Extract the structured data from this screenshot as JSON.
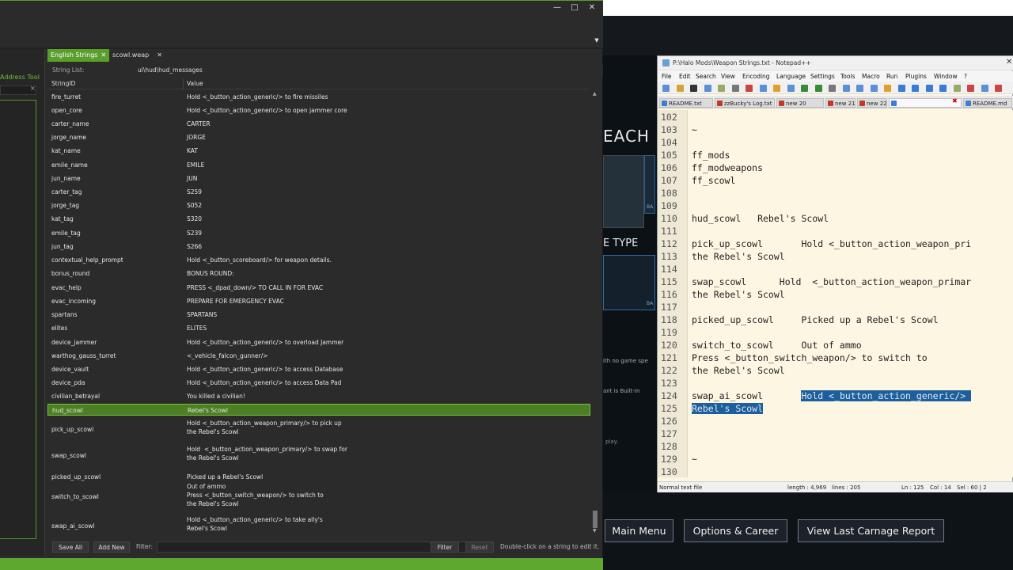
{
  "editor": {
    "address_tool": "Address Tool",
    "tabs": [
      {
        "label": "English Strings",
        "active": true
      },
      {
        "label": "scowl.weap",
        "active": false
      }
    ],
    "string_list_label": "String List:",
    "string_list_value": "ui\\hud\\hud_messages",
    "columns": {
      "id": "StringID",
      "value": "Value"
    },
    "rows": [
      {
        "id": "fire_turret",
        "value": "Hold <_button_action_generic/> to fire missiles"
      },
      {
        "id": "open_core",
        "value": "Hold <_button_action_generic/> to open jammer core"
      },
      {
        "id": "carter_name",
        "value": "CARTER"
      },
      {
        "id": "jorge_name",
        "value": "JORGE"
      },
      {
        "id": "kat_name",
        "value": "KAT"
      },
      {
        "id": "emile_name",
        "value": "EMILE"
      },
      {
        "id": "jun_name",
        "value": "JUN"
      },
      {
        "id": "carter_tag",
        "value": "S259"
      },
      {
        "id": "jorge_tag",
        "value": "S052"
      },
      {
        "id": "kat_tag",
        "value": "S320"
      },
      {
        "id": "emile_tag",
        "value": "S239"
      },
      {
        "id": "jun_tag",
        "value": "S266"
      },
      {
        "id": "contextual_help_prompt",
        "value": "Hold <_button_scoreboard/> for weapon details."
      },
      {
        "id": "bonus_round",
        "value": "BONUS ROUND:"
      },
      {
        "id": "evac_help",
        "value": "PRESS <_dpad_down/> TO CALL IN FOR EVAC"
      },
      {
        "id": "evac_incoming",
        "value": "PREPARE FOR EMERGENCY EVAC"
      },
      {
        "id": "spartans",
        "value": "SPARTANS"
      },
      {
        "id": "elites",
        "value": "ELITES"
      },
      {
        "id": "device_jammer",
        "value": "Hold <_button_action_generic/> to overload Jammer"
      },
      {
        "id": "warthog_gauss_turret",
        "value": "<_vehicle_falcon_gunner/>"
      },
      {
        "id": "device_vault",
        "value": "Hold <_button_action_generic/> to access Database"
      },
      {
        "id": "device_pda",
        "value": "Hold <_button_action_generic/> to access Data Pad"
      },
      {
        "id": "civilian_betrayal",
        "value": "You killed a civilian!"
      },
      {
        "id": "hud_scowl",
        "value": "Rebel's Scowl",
        "selected": true
      },
      {
        "id": "pick_up_scowl",
        "value": "Hold <_button_action_weapon_primary/> to pick up\nthe Rebel's Scowl"
      },
      {
        "id": "swap_scowl",
        "value": "Hold  <_button_action_weapon_primary/> to swap for\nthe Rebel's Scowl"
      },
      {
        "id": "picked_up_scowl",
        "value": "Picked up a Rebel's Scowl"
      },
      {
        "id": "switch_to_scowl",
        "value": "Out of ammo\nPress <_button_switch_weapon/> to switch to\nthe Rebel's Scowl"
      },
      {
        "id": "swap_ai_scowl",
        "value": "Hold <_button_action_generic/> to take ally's\nRebel's Scowl"
      }
    ],
    "buttons": {
      "save_all": "Save All",
      "add_new": "Add New",
      "filter": "Filter",
      "reset": "Reset"
    },
    "filter_label": "Filter:",
    "hint": "Double-click on a string to edit it."
  },
  "game": {
    "fragments": [
      "EACH F",
      "E TYPE",
      "ith no game spe",
      "ant is Built-In",
      "play."
    ],
    "badges": [
      "BA",
      "BA"
    ],
    "buttons": {
      "main_menu": "Main Menu",
      "options": "Options & Career",
      "carnage": "View Last Carnage Report"
    }
  },
  "npp": {
    "title": "P:\\Halo Mods\\Weapon Strings.txt - Notepad++",
    "menu": [
      "File",
      "Edit",
      "Search",
      "View",
      "Encoding",
      "Language",
      "Settings",
      "Tools",
      "Macro",
      "Run",
      "Plugins",
      "Window",
      "?"
    ],
    "tabs": [
      "README.txt",
      "zzBucky's Log.txt",
      "new 20",
      "new 21",
      "new 22",
      "",
      "README.md"
    ],
    "lines": [
      {
        "n": "102",
        "text": ""
      },
      {
        "n": "103",
        "text": "~"
      },
      {
        "n": "104",
        "text": ""
      },
      {
        "n": "105",
        "text": "ff_mods"
      },
      {
        "n": "106",
        "text": "ff_modweapons"
      },
      {
        "n": "107",
        "text": "ff_scowl"
      },
      {
        "n": "108",
        "text": ""
      },
      {
        "n": "109",
        "text": ""
      },
      {
        "n": "110",
        "text": "hud_scowl   Rebel's Scowl"
      },
      {
        "n": "111",
        "text": ""
      },
      {
        "n": "112",
        "text": "pick_up_scowl       Hold <_button_action_weapon_pri"
      },
      {
        "n": "113",
        "text": "the Rebel's Scowl"
      },
      {
        "n": "114",
        "text": ""
      },
      {
        "n": "115",
        "text": "swap_scowl      Hold  <_button_action_weapon_primar"
      },
      {
        "n": "116",
        "text": "the Rebel's Scowl"
      },
      {
        "n": "117",
        "text": ""
      },
      {
        "n": "118",
        "text": "picked_up_scowl     Picked up a Rebel's Scowl"
      },
      {
        "n": "119",
        "text": ""
      },
      {
        "n": "120",
        "text": "switch_to_scowl     Out of ammo"
      },
      {
        "n": "121",
        "text": "Press <_button_switch_weapon/> to switch to"
      },
      {
        "n": "122",
        "text": "the Rebel's Scowl"
      },
      {
        "n": "123",
        "text": ""
      },
      {
        "n": "124",
        "text": "swap_ai_scowl       ",
        "highlight": "Hold <_button_action_generic/> "
      },
      {
        "n": "125",
        "text": "",
        "highlight": "Rebel's Scowl"
      },
      {
        "n": "126",
        "text": ""
      },
      {
        "n": "127",
        "text": ""
      },
      {
        "n": "128",
        "text": ""
      },
      {
        "n": "129",
        "text": "~"
      },
      {
        "n": "130",
        "text": ""
      }
    ],
    "status": {
      "type": "Normal text file",
      "length": "length : 4,969",
      "lines": "lines : 205",
      "ln": "Ln : 125",
      "col": "Col : 14",
      "sel": "Sel : 60 | 2"
    }
  }
}
